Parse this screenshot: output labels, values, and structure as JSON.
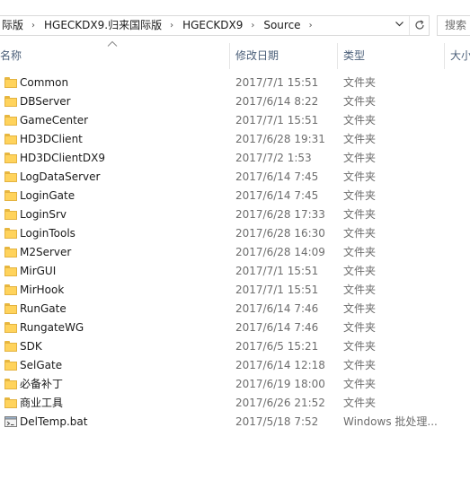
{
  "address_bar": {
    "crumbs": [
      "际版",
      "HGECKDX9.归来国际版",
      "HGECKDX9",
      "Source"
    ],
    "separator": "›",
    "dropdown_icon": "chevron-down-icon",
    "refresh_icon": "refresh-icon"
  },
  "search": {
    "placeholder": "搜索"
  },
  "columns": {
    "name": "名称",
    "date": "修改日期",
    "type": "类型",
    "size": "大小"
  },
  "sort": {
    "column": "name",
    "direction": "ascending"
  },
  "files": [
    {
      "name": "Common",
      "date": "2017/7/1 15:51",
      "type": "文件夹",
      "icon": "folder-icon"
    },
    {
      "name": "DBServer",
      "date": "2017/6/14 8:22",
      "type": "文件夹",
      "icon": "folder-icon"
    },
    {
      "name": "GameCenter",
      "date": "2017/7/1 15:51",
      "type": "文件夹",
      "icon": "folder-icon"
    },
    {
      "name": "HD3DClient",
      "date": "2017/6/28 19:31",
      "type": "文件夹",
      "icon": "folder-icon"
    },
    {
      "name": "HD3DClientDX9",
      "date": "2017/7/2 1:53",
      "type": "文件夹",
      "icon": "folder-icon"
    },
    {
      "name": "LogDataServer",
      "date": "2017/6/14 7:45",
      "type": "文件夹",
      "icon": "folder-icon"
    },
    {
      "name": "LoginGate",
      "date": "2017/6/14 7:45",
      "type": "文件夹",
      "icon": "folder-icon"
    },
    {
      "name": "LoginSrv",
      "date": "2017/6/28 17:33",
      "type": "文件夹",
      "icon": "folder-icon"
    },
    {
      "name": "LoginTools",
      "date": "2017/6/28 16:30",
      "type": "文件夹",
      "icon": "folder-icon"
    },
    {
      "name": "M2Server",
      "date": "2017/6/28 14:09",
      "type": "文件夹",
      "icon": "folder-icon"
    },
    {
      "name": "MirGUI",
      "date": "2017/7/1 15:51",
      "type": "文件夹",
      "icon": "folder-icon"
    },
    {
      "name": "MirHook",
      "date": "2017/7/1 15:51",
      "type": "文件夹",
      "icon": "folder-icon"
    },
    {
      "name": "RunGate",
      "date": "2017/6/14 7:46",
      "type": "文件夹",
      "icon": "folder-icon"
    },
    {
      "name": "RungateWG",
      "date": "2017/6/14 7:46",
      "type": "文件夹",
      "icon": "folder-icon"
    },
    {
      "name": "SDK",
      "date": "2017/6/5 15:21",
      "type": "文件夹",
      "icon": "folder-icon"
    },
    {
      "name": "SelGate",
      "date": "2017/6/14 12:18",
      "type": "文件夹",
      "icon": "folder-icon"
    },
    {
      "name": "必备补丁",
      "date": "2017/6/19 18:00",
      "type": "文件夹",
      "icon": "folder-icon"
    },
    {
      "name": "商业工具",
      "date": "2017/6/26 21:52",
      "type": "文件夹",
      "icon": "folder-icon"
    },
    {
      "name": "DelTemp.bat",
      "date": "2017/5/18 7:52",
      "type": "Windows 批处理...",
      "icon": "batch-file-icon"
    }
  ],
  "colors": {
    "folder": "#ffd35c",
    "folder_border": "#e3b341",
    "header_text": "#4c607a",
    "secondary_text": "#6d6d6d"
  }
}
